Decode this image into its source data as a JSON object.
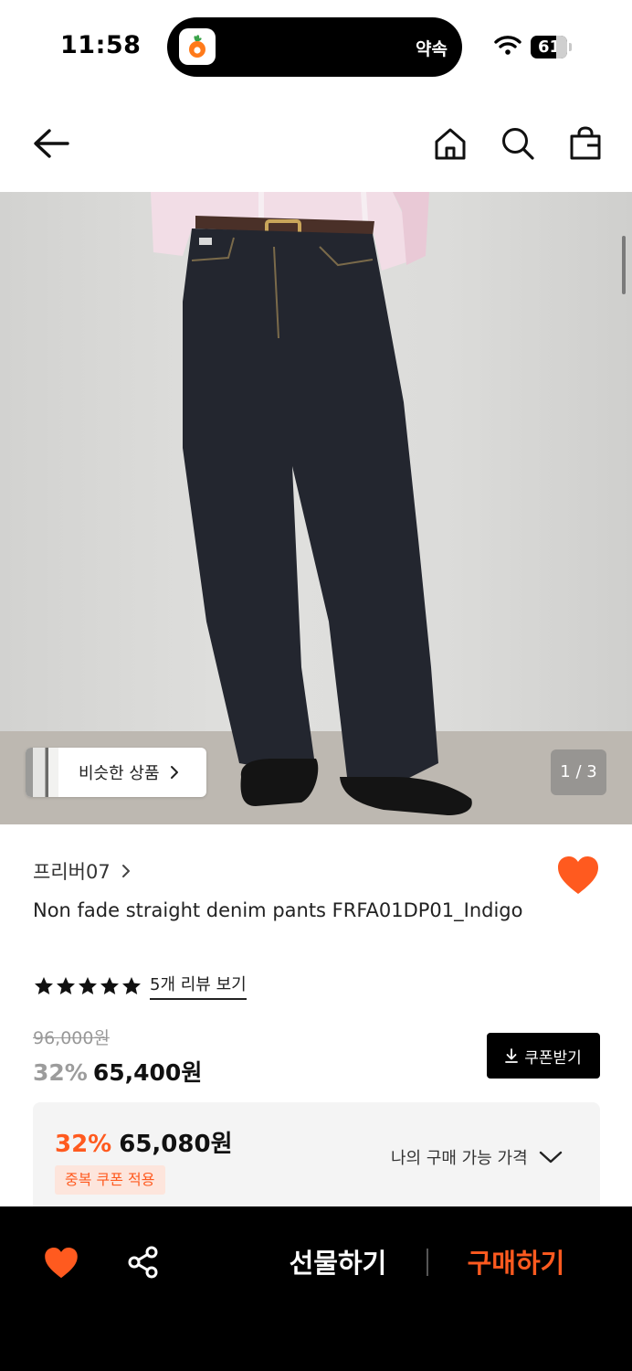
{
  "status_bar": {
    "time": "11:58",
    "island_text": "약속",
    "battery": "61"
  },
  "nav": {
    "back_icon": "arrow-left-icon",
    "home_icon": "home-icon",
    "search_icon": "search-icon",
    "bag_icon": "shopping-bag-icon"
  },
  "gallery": {
    "similar_label": "비슷한 상품",
    "counter": "1 / 3"
  },
  "product": {
    "brand": "프리버07",
    "title": "Non fade straight denim pants FRFA01DP01_Indigo",
    "rating_stars": 5,
    "review_link": "5개 리뷰 보기",
    "original_price": "96,000원",
    "discount_pct": "32%",
    "sale_price": "65,400원",
    "coupon_label": "쿠폰받기",
    "best_pct": "32%",
    "best_price": "65,080원",
    "dup_coupon": "중복 쿠폰 적용",
    "my_price_label": "나의 구매 가능 가격",
    "wishlisted": true
  },
  "bottom_bar": {
    "gift_label": "선물하기",
    "buy_label": "구매하기"
  },
  "colors": {
    "accent": "#ff5a1f",
    "dark": "#000000",
    "badge_bg": "#fde5dc",
    "panel_bg": "#f4f4f4"
  }
}
